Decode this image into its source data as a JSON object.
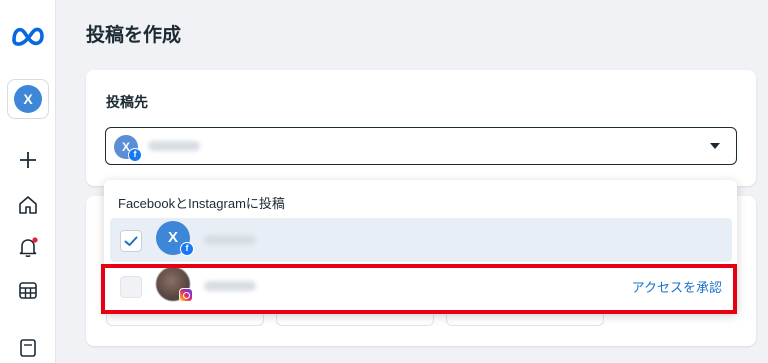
{
  "rail": {
    "account_initial": "X",
    "icons": [
      "meta-logo-icon",
      "plus-icon",
      "home-icon",
      "bell-icon",
      "calendar-icon",
      "list-icon"
    ]
  },
  "page": {
    "title": "投稿を作成"
  },
  "post_to": {
    "label": "投稿先",
    "selected_initial": "X"
  },
  "dropdown": {
    "heading": "FacebookとInstagramに投稿",
    "rows": [
      {
        "initial": "X",
        "platform": "facebook",
        "checked": true
      },
      {
        "initial": "",
        "platform": "instagram",
        "checked": false,
        "action": "アクセスを承認"
      }
    ]
  },
  "colors": {
    "brand_blue": "#1877f2",
    "link_blue": "#1a73c9",
    "highlight_red": "#e60012",
    "selected_row": "#e7eef6"
  }
}
